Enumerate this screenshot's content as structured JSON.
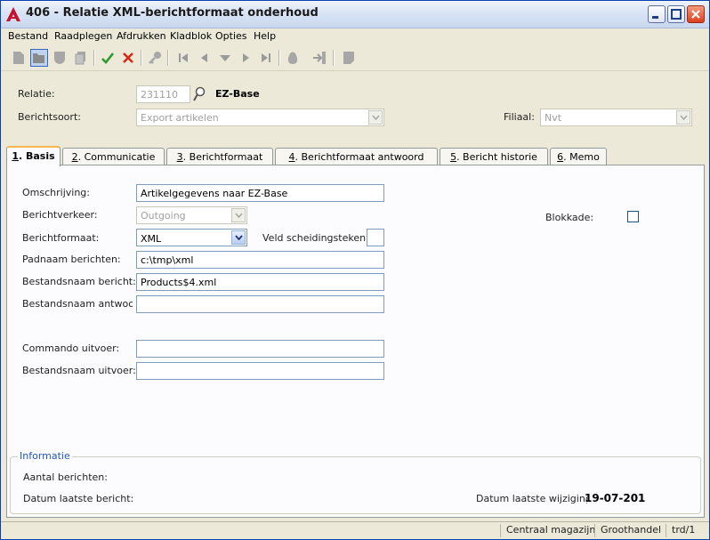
{
  "window": {
    "title": "406 - Relatie XML-berichtformaat onderhoud"
  },
  "menu": [
    "Bestand",
    "Raadplegen",
    "Afdrukken",
    "Kladblok",
    "Opties",
    "Help"
  ],
  "header": {
    "relatie_label": "Relatie:",
    "relatie_value": "231110",
    "relatie_name": "EZ-Base",
    "berichtsoort_label": "Berichtsoort:",
    "berichtsoort_value": "Export artikelen",
    "filiaal_label": "Filiaal:",
    "filiaal_value": "Nvt"
  },
  "tabs": [
    {
      "key": "1",
      "label": ". Basis"
    },
    {
      "key": "2",
      "label": ". Communicatie"
    },
    {
      "key": "3",
      "label": ". Berichtformaat"
    },
    {
      "key": "4",
      "label": ". Berichtformaat antwoord"
    },
    {
      "key": "5",
      "label": ". Bericht historie"
    },
    {
      "key": "6",
      "label": ". Memo"
    }
  ],
  "form": {
    "omschrijving_label": "Omschrijving:",
    "omschrijving_value": "Artikelgegevens naar EZ-Base",
    "berichtverkeer_label": "Berichtverkeer:",
    "berichtverkeer_value": "Outgoing",
    "berichtformaat_label": "Berichtformaat:",
    "berichtformaat_value": "XML",
    "veld_label": "Veld scheidingsteken:",
    "veld_value": "",
    "padnaam_label": "Padnaam berichten:",
    "padnaam_value": "c:\\tmp\\xml",
    "bestandsnaam_label": "Bestandsnaam bericht:",
    "bestandsnaam_value": "Products$4.xml",
    "antwoord_label": "Bestandsnaam antwoord",
    "antwoord_value": "",
    "commando_label": "Commando uitvoer:",
    "commando_value": "",
    "uitvoer_label": "Bestandsnaam uitvoer:",
    "uitvoer_value": "",
    "blokkade_label": "Blokkade:",
    "blokkade_checked": false
  },
  "info": {
    "legend": "Informatie",
    "aantal_label": "Aantal berichten:",
    "datum_laatste_label": "Datum laatste bericht:",
    "wijziging_label": "Datum laatste wijziging:",
    "wijziging_value": "19-07-201"
  },
  "status": {
    "location": "Centraal magazijn",
    "segment": "Groothandel",
    "user": "trd/1"
  }
}
